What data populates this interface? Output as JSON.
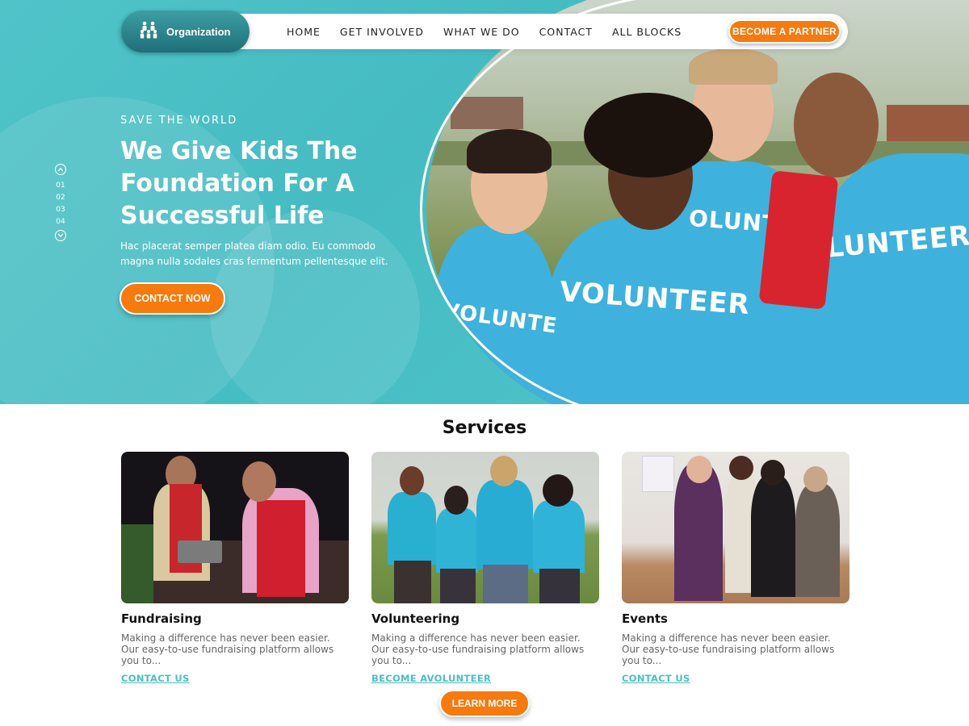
{
  "brand": {
    "logo_text": "Organization",
    "logo_icon": "people-group-icon"
  },
  "nav": {
    "items": [
      "HOME",
      "GET INVOLVED",
      "WHAT WE DO",
      "CONTACT",
      "ALL BLOCKS"
    ],
    "cta_label": "BECOME A PARTNER"
  },
  "hero": {
    "eyebrow": "SAVE THE WORLD",
    "title": "We Give Kids The Foundation For A Successful Life",
    "description": "Hac placerat semper platea diam odio. Eu commodo magna nulla sodales cras fermentum pellentesque elit.",
    "cta_label": "CONTACT NOW",
    "slider": {
      "up_icon": "chevron-up-icon",
      "down_icon": "chevron-down-icon",
      "slides": [
        "01",
        "02",
        "03",
        "04"
      ]
    }
  },
  "services": {
    "title": "Services",
    "cards": [
      {
        "title": "Fundraising",
        "description": "Making a difference has never been easier. Our easy-to-use  fundraising platform allows you to...",
        "link": "CONTACT US"
      },
      {
        "title": "Volunteering",
        "description": "Making a difference has never been easier. Our easy-to-use  fundraising platform allows you to...",
        "link": "BECOME AVOLUNTEER"
      },
      {
        "title": "Events",
        "description": "Making a difference has never been easier. Our easy-to-use  fundraising platform allows you to...",
        "link": "CONTACT US"
      }
    ],
    "cta_label": "LEARN MORE"
  },
  "colors": {
    "teal": "#4fc3c8",
    "orange": "#f67a0e",
    "link": "#4bbfc7",
    "dark_teal": "#1f6f77"
  }
}
